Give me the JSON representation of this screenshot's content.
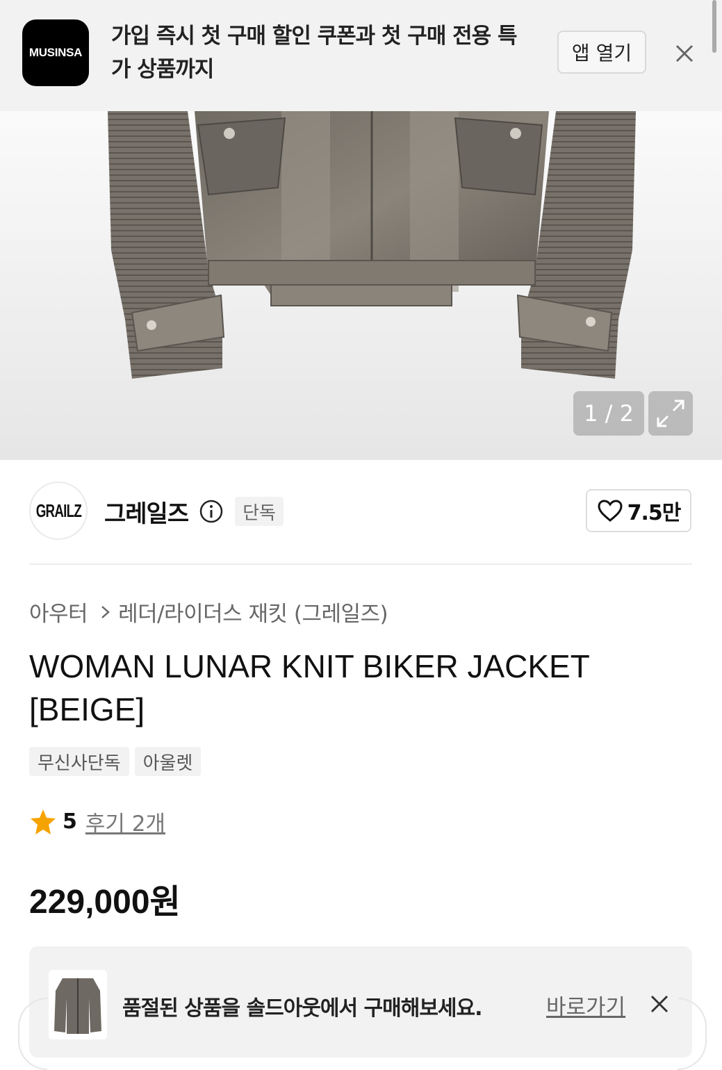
{
  "app_banner": {
    "logo_text": "MUSINSA",
    "message": "가입 즉시 첫 구매 할인 쿠폰과 첫 구매 전용 특가 상품까지",
    "open_app_label": "앱 열기",
    "close_icon": "close-icon"
  },
  "gallery": {
    "page_indicator": "1 / 2",
    "expand_icon": "expand-icon"
  },
  "brand": {
    "logo_text": "GRAILZ",
    "name": "그레일즈",
    "info_icon": "info-icon",
    "exclusive_label": "단독",
    "likes": "7.5만",
    "like_icon": "heart-icon"
  },
  "breadcrumb": {
    "category": "아우터",
    "subcategory": "레더/라이더스 재킷 (그레일즈)"
  },
  "product": {
    "title": "WOMAN LUNAR KNIT BIKER JACKET [BEIGE]",
    "tags": [
      "무신사단독",
      "아울렛"
    ],
    "rating": "5",
    "review_link": "후기 2개",
    "price": "229,000원"
  },
  "soldout_banner": {
    "message": "품절된 상품을 솔드아웃에서 구매해보세요.",
    "link_label": "바로가기",
    "close_icon": "close-icon"
  },
  "colors": {
    "accent_star": "#f5a300",
    "text_primary": "#111111",
    "banner_bg": "#f2f2f2"
  }
}
